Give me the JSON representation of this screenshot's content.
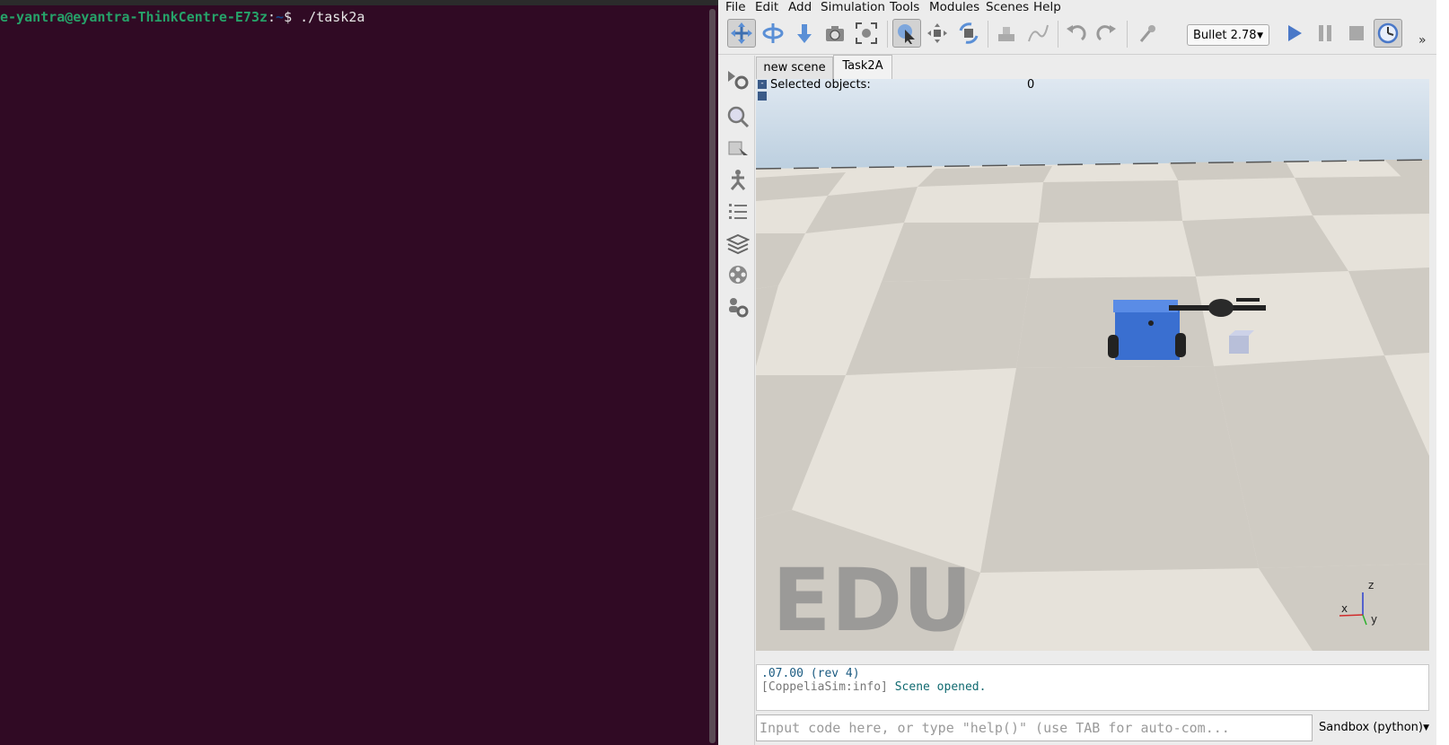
{
  "terminal": {
    "user_host": "e-yantra@eyantra-ThinkCentre-E73z",
    "separator": ":",
    "path": "~",
    "prompt_symbol": "$ ",
    "command": "./task2a"
  },
  "menu": [
    "File",
    "Edit",
    "Add",
    "Simulation",
    "Tools",
    "Modules",
    "Scenes",
    "Help"
  ],
  "toolbar": {
    "physics_engine": "Bullet 2.78",
    "more_glyph": "»"
  },
  "tabs": [
    "new scene",
    "Task2A"
  ],
  "viewport": {
    "selected_label": "Selected objects:",
    "selected_count": "0",
    "watermark": "EDU",
    "axes": {
      "x": "x",
      "y": "y",
      "z": "z"
    },
    "colors": {
      "sky": "#c6d8e6",
      "floor_light": "#e8e4dc",
      "floor_dark": "#cfcbc3",
      "robot": "#3a6fd0"
    }
  },
  "console": {
    "line1": ".07.00 (rev 4)",
    "line2_tag": "[CoppeliaSim:info]",
    "line2_msg": " Scene opened."
  },
  "input": {
    "placeholder": "Input code here, or type \"help()\" (use TAB for auto-com..."
  },
  "sandbox": "Sandbox (python)"
}
